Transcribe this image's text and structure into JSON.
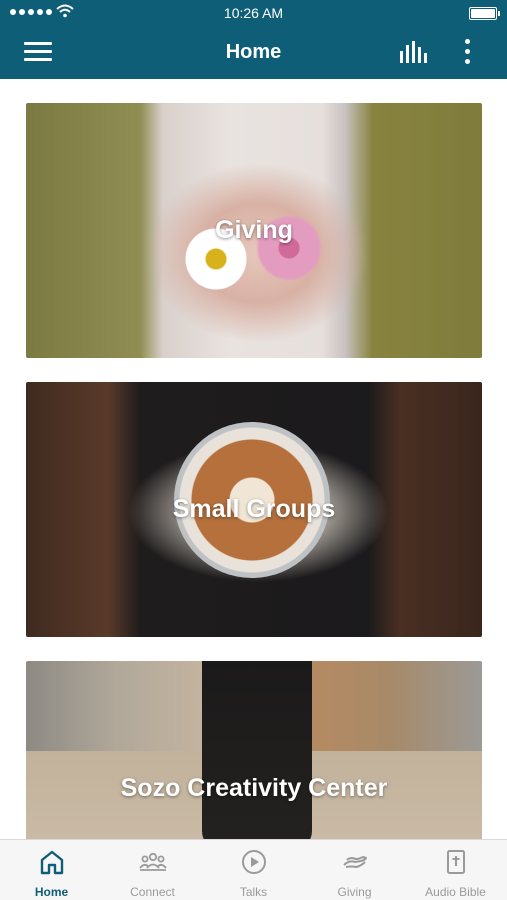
{
  "status_bar": {
    "time": "10:26 AM"
  },
  "header": {
    "title": "Home"
  },
  "cards": [
    {
      "label": "Giving"
    },
    {
      "label": "Small Groups"
    },
    {
      "label": "Sozo Creativity Center"
    }
  ],
  "tabbar": {
    "items": [
      {
        "label": "Home",
        "icon": "home-icon",
        "active": true
      },
      {
        "label": "Connect",
        "icon": "people-icon",
        "active": false
      },
      {
        "label": "Talks",
        "icon": "play-circle-icon",
        "active": false
      },
      {
        "label": "Giving",
        "icon": "giving-hand-icon",
        "active": false
      },
      {
        "label": "Audio Bible",
        "icon": "bible-icon",
        "active": false
      }
    ]
  },
  "colors": {
    "primary": "#0f5e78",
    "tab_inactive": "#9a9a9a",
    "tab_bar_bg": "#f6f6f6"
  }
}
